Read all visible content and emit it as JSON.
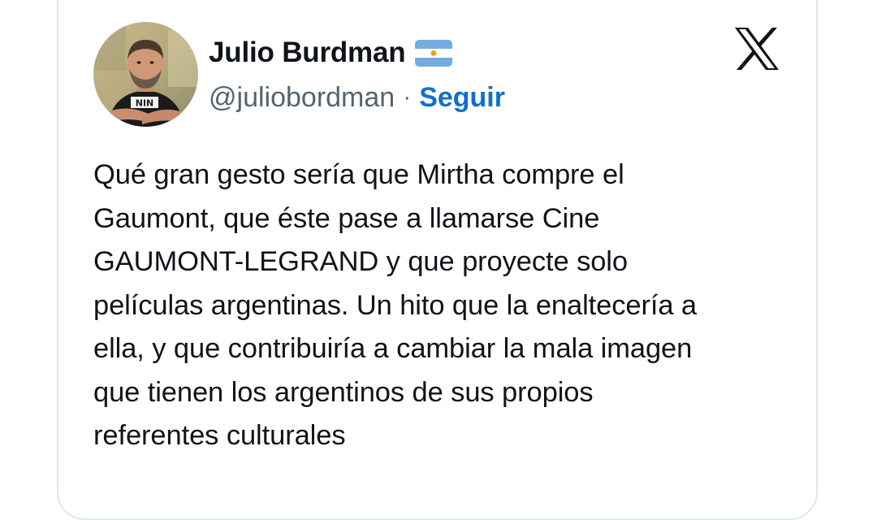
{
  "author": {
    "display_name": "Julio Burdman",
    "handle": "@juliobordman",
    "separator": "·",
    "follow_label": "Seguir",
    "flag_icon": "argentina-flag-icon",
    "avatar_shirt_text": "NIN"
  },
  "brand": {
    "logo_icon": "x-logo-icon"
  },
  "tweet": {
    "text": "Qué gran gesto sería que Mirtha compre el\nGaumont, que éste pase a llamarse Cine\nGAUMONT-LEGRAND y que proyecte solo\npelículas argentinas. Un hito que la enaltecería a\nella, y que contribuiría a cambiar la mala imagen\nque tienen los argentinos de sus propios\nreferentes culturales"
  },
  "colors": {
    "text": "#0f1419",
    "secondary": "#536471",
    "link": "#1170c9",
    "border": "#e3e6e9"
  }
}
